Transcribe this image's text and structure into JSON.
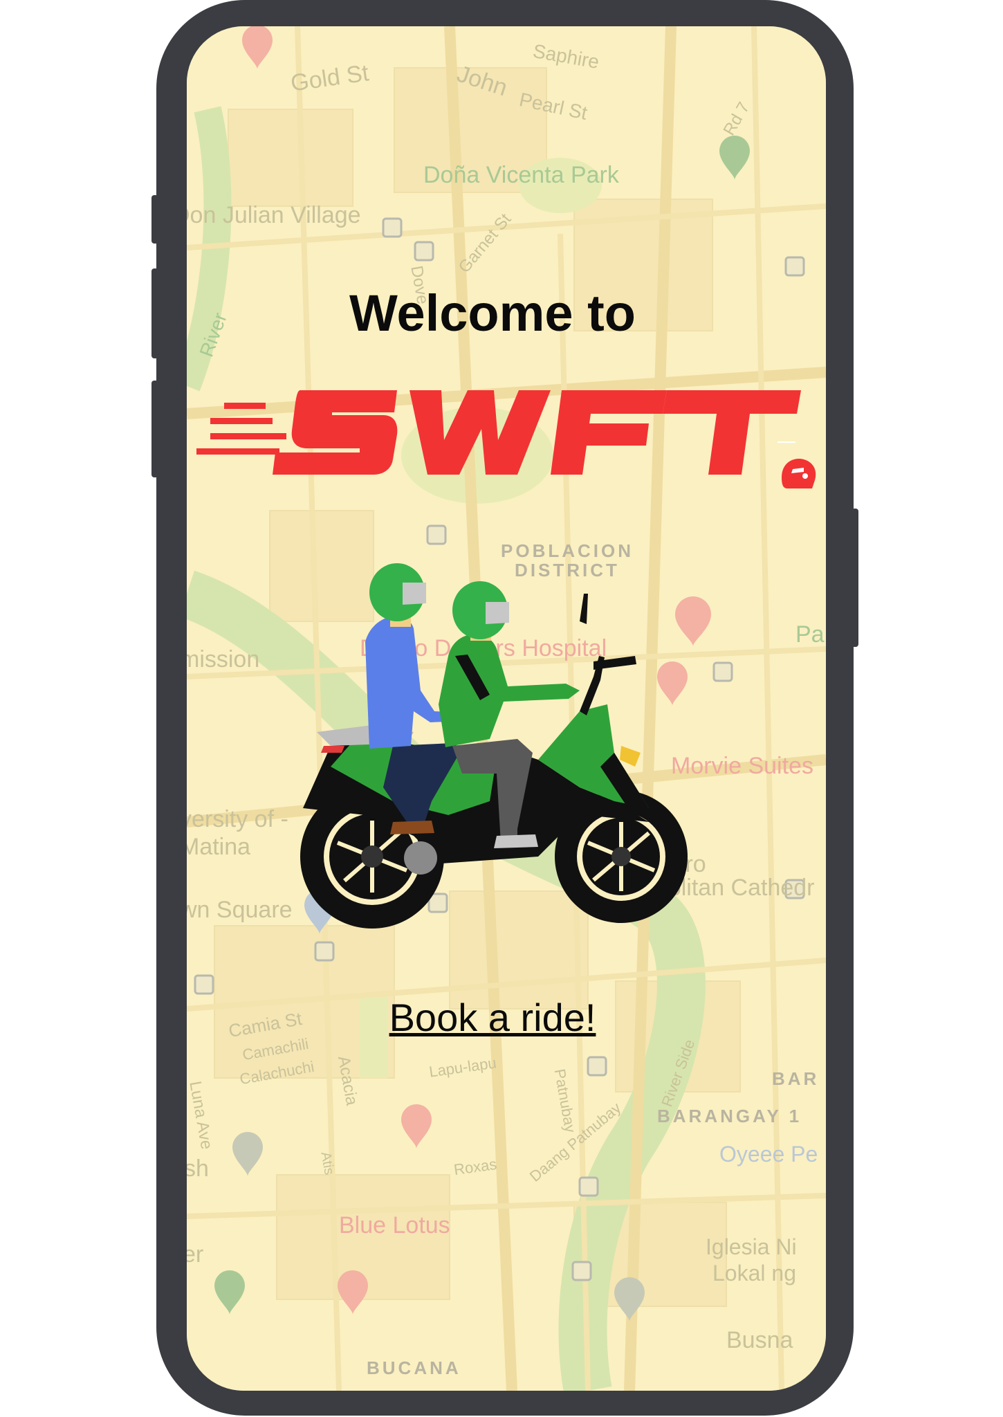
{
  "welcome_text": "Welcome to",
  "brand": {
    "name": "SWFT",
    "color": "#f23333"
  },
  "cta": {
    "label": "Book a ride!"
  },
  "map": {
    "labels": {
      "gold_st": "Gold St",
      "john": "John",
      "pearl_st": "Pearl St",
      "saphire": "Saphire",
      "rd7": "Rd 7",
      "dona_vicenta_park": "Doña Vicenta Park",
      "don_julian_village": "Don Julian Village",
      "garnet_st": "Garnet St",
      "dove": "Dove",
      "river": "River",
      "poblacion_district": "POBLACION DISTRICT",
      "mission": "mission",
      "davao_doctors_hospital": "Davao Doctors Hospital",
      "pa": "Pa",
      "morvie_suites": "Morvie Suites",
      "university_of_mindanao_matina": "versity of - Matina",
      "town_square": "wn Square",
      "san_pedro_cathedral": "San Pedro Metropolitan Cathedr",
      "camia_st": "Camia St",
      "camachili": "Camachili",
      "calachuchi": "Calachuchi",
      "acacia": "Acacia",
      "lapu_lapu": "Lapu-lapu",
      "patnubay": "Patnubay",
      "river_side": "River Side",
      "luna_ave": "Luna Ave",
      "bar": "BAR",
      "barangay_1": "BARANGAY 1",
      "oyeee": "Oyeee Pe",
      "sh": "sh",
      "atis": "Atis",
      "roxas": "Roxas",
      "daang_patnubay": "Daang Patnubay",
      "blue_lotus": "Blue Lotus",
      "iglesia": "Iglesia Ni",
      "lokal": "Lokal ng",
      "er": "er",
      "busna": "Busna",
      "bucana": "BUCANA"
    }
  }
}
